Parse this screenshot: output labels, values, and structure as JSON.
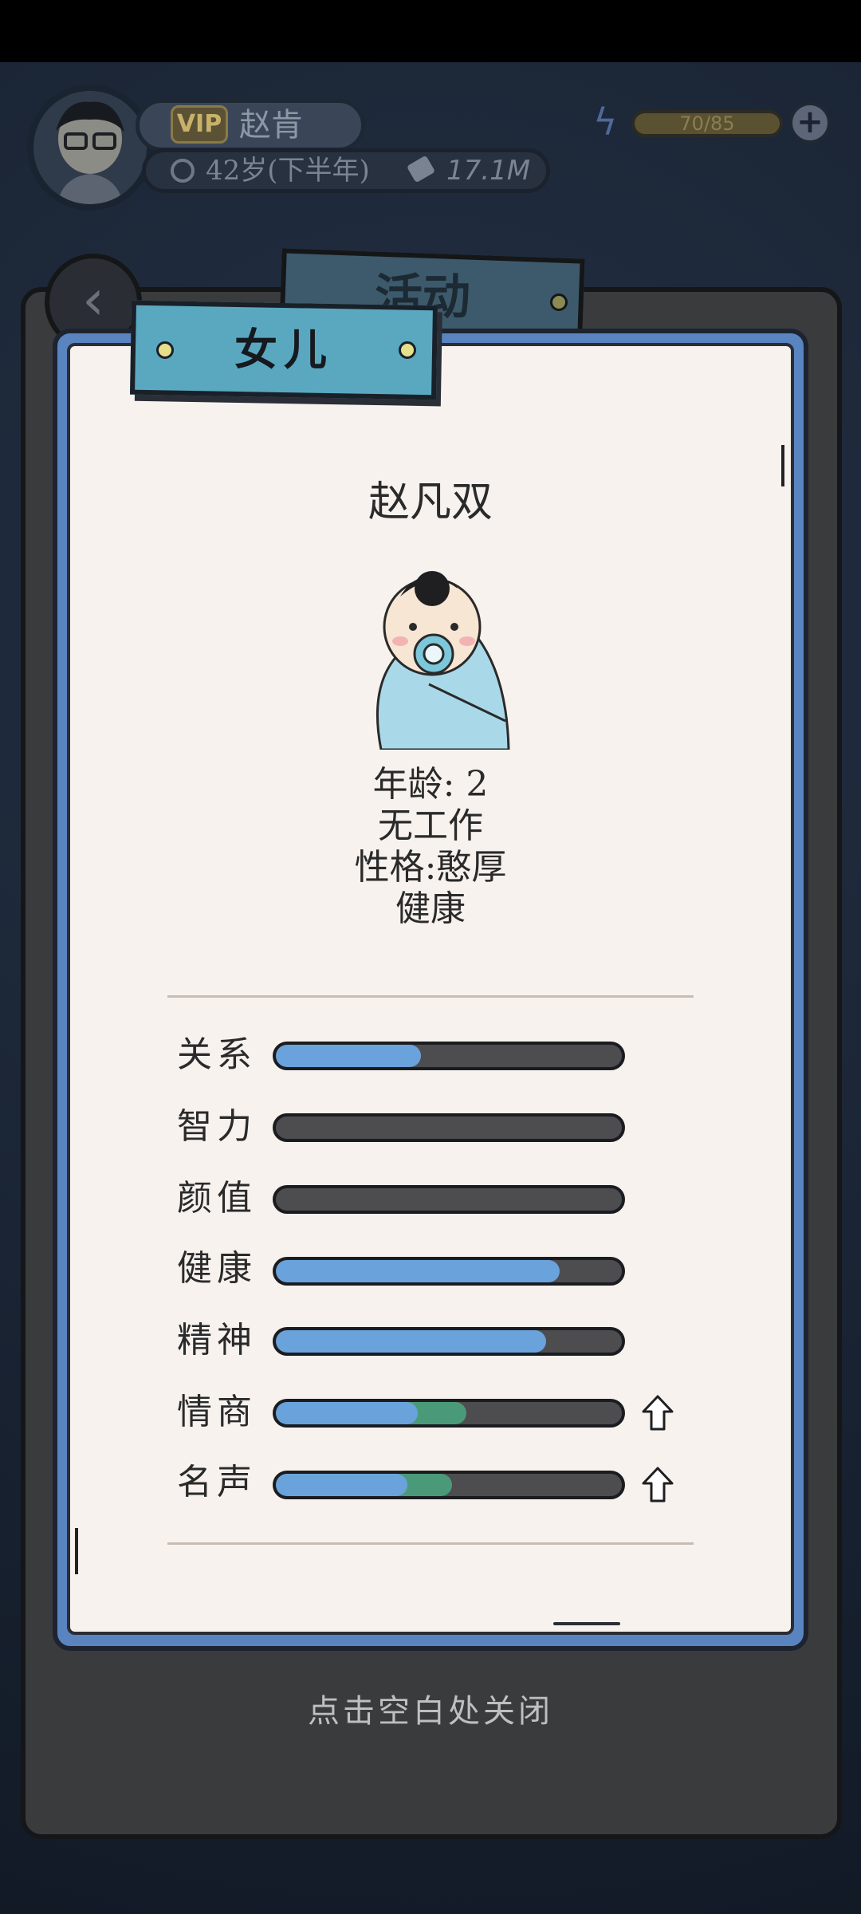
{
  "header": {
    "vip_label": "VIP",
    "player_name": "赵肯",
    "age": "42岁(下半年)",
    "money": "17.1M",
    "energy": "70/85",
    "plus_symbol": "+"
  },
  "behind_tab": {
    "label": "活动"
  },
  "card": {
    "title": "女儿",
    "child_name": "赵凡双",
    "age_line": "年龄: 2",
    "job_line": "无工作",
    "personality_line": "性格:憨厚",
    "health_line": "健康",
    "stats": [
      {
        "label": "关系",
        "value": 0.42,
        "secondary": 0,
        "upgrade": false
      },
      {
        "label": "智力",
        "value": 0.0,
        "secondary": 0,
        "upgrade": false
      },
      {
        "label": "颜值",
        "value": 0.0,
        "secondary": 0,
        "upgrade": false
      },
      {
        "label": "健康",
        "value": 0.82,
        "secondary": 0,
        "upgrade": false
      },
      {
        "label": "精神",
        "value": 0.78,
        "secondary": 0,
        "upgrade": false
      },
      {
        "label": "情商",
        "value": 0.41,
        "secondary": 0.55,
        "upgrade": true
      },
      {
        "label": "名声",
        "value": 0.38,
        "secondary": 0.51,
        "upgrade": true
      }
    ]
  },
  "close_hint": "点击空白处关闭",
  "colors": {
    "bar_fill": "#6aa2dc",
    "bar_bonus": "#4a9a7a",
    "bar_empty": "#4d4d4f",
    "card_frame": "#5a84c0",
    "title_tab": "#5aa8c0"
  }
}
